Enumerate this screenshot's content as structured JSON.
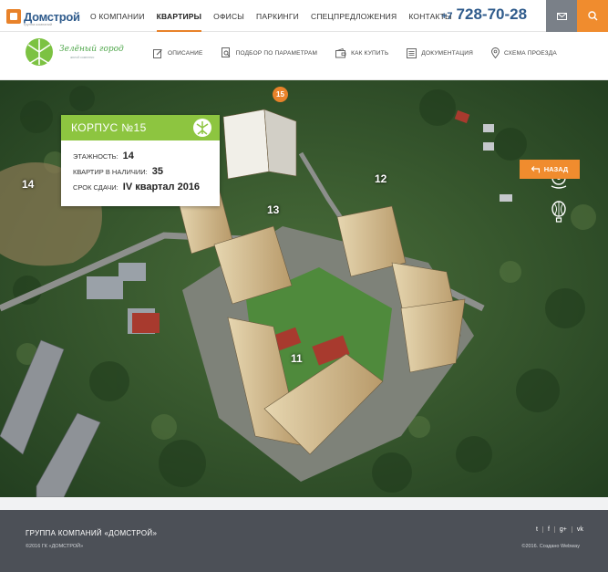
{
  "brand": {
    "name": "Домстрой",
    "tagline": "группа компаний"
  },
  "nav": {
    "items": [
      "О КОМПАНИИ",
      "КВАРТИРЫ",
      "ОФИСЫ",
      "ПАРКИНГИ",
      "СПЕЦПРЕДЛОЖЕНИЯ",
      "КОНТАКТЫ"
    ],
    "active": "КВАРТИРЫ"
  },
  "phone": {
    "code": "+7",
    "number": "728-70-28"
  },
  "project": {
    "name": "Зелёный город",
    "tagline": "жилой комплекс"
  },
  "subnav": [
    "ОПИСАНИЕ",
    "ПОДБОР ПО ПАРАМЕТРАМ",
    "КАК КУПИТЬ",
    "ДОКУМЕНТАЦИЯ",
    "СХЕМА ПРОЕЗДА"
  ],
  "building_labels": {
    "b15": "15",
    "b14": "14",
    "b13": "13",
    "b12": "12",
    "b11": "11"
  },
  "infocard": {
    "title": "КОРПУС №15",
    "floors_label": "ЭТАЖНОСТЬ:",
    "floors_value": "14",
    "available_label": "КВАРТИР В НАЛИЧИИ:",
    "available_value": "35",
    "deadline_label": "СРОК СДАЧИ:",
    "deadline_value": "IV квартал 2016"
  },
  "back_button": "НАЗАД",
  "footer": {
    "title": "ГРУППА КОМПАНИЙ «ДОМСТРОЙ»",
    "copyright": "©2016 ГК «ДОМСТРОЙ»",
    "social": [
      "t",
      "f",
      "g+",
      "vk"
    ],
    "credits": "©2016. Создано Webway"
  },
  "colors": {
    "accent": "#f08c2e",
    "brand_blue": "#2f5b8c",
    "green": "#8dc540",
    "footer_bg": "#4c5057"
  }
}
